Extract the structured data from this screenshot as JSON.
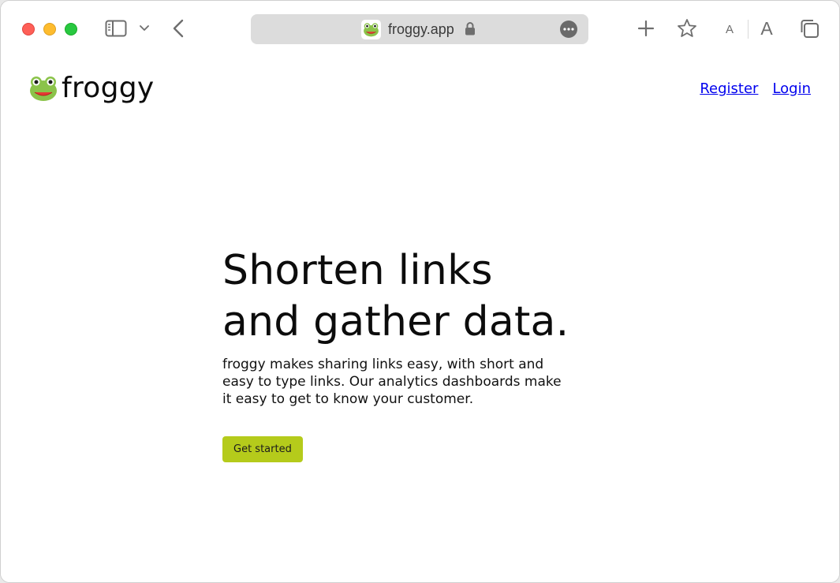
{
  "browser": {
    "url": "froggy.app",
    "icons": [
      "sidebar-icon",
      "chevron-down-icon",
      "back-arrow-icon",
      "lock-icon",
      "more-options-icon",
      "plus-icon",
      "star-icon",
      "tabs-overview-icon"
    ],
    "font_decrease_label": "A",
    "font_increase_label": "A"
  },
  "site": {
    "brand": "froggy",
    "logo_icon": "frog-face-icon",
    "nav": {
      "register": "Register",
      "login": "Login"
    },
    "hero": {
      "title_line1": "Shorten links",
      "title_line2": "and gather data.",
      "subtitle": "froggy makes sharing links easy, with short and easy to type links. Our analytics dashboards make it easy to get to know your customer.",
      "cta_label": "Get started"
    }
  },
  "colors": {
    "accent": "#b5cb1b",
    "link": "#0000ee",
    "text": "#0c0c0c",
    "traffic_close": "#fe5f57",
    "traffic_minimize": "#febc2e",
    "traffic_maximize": "#28c840"
  }
}
